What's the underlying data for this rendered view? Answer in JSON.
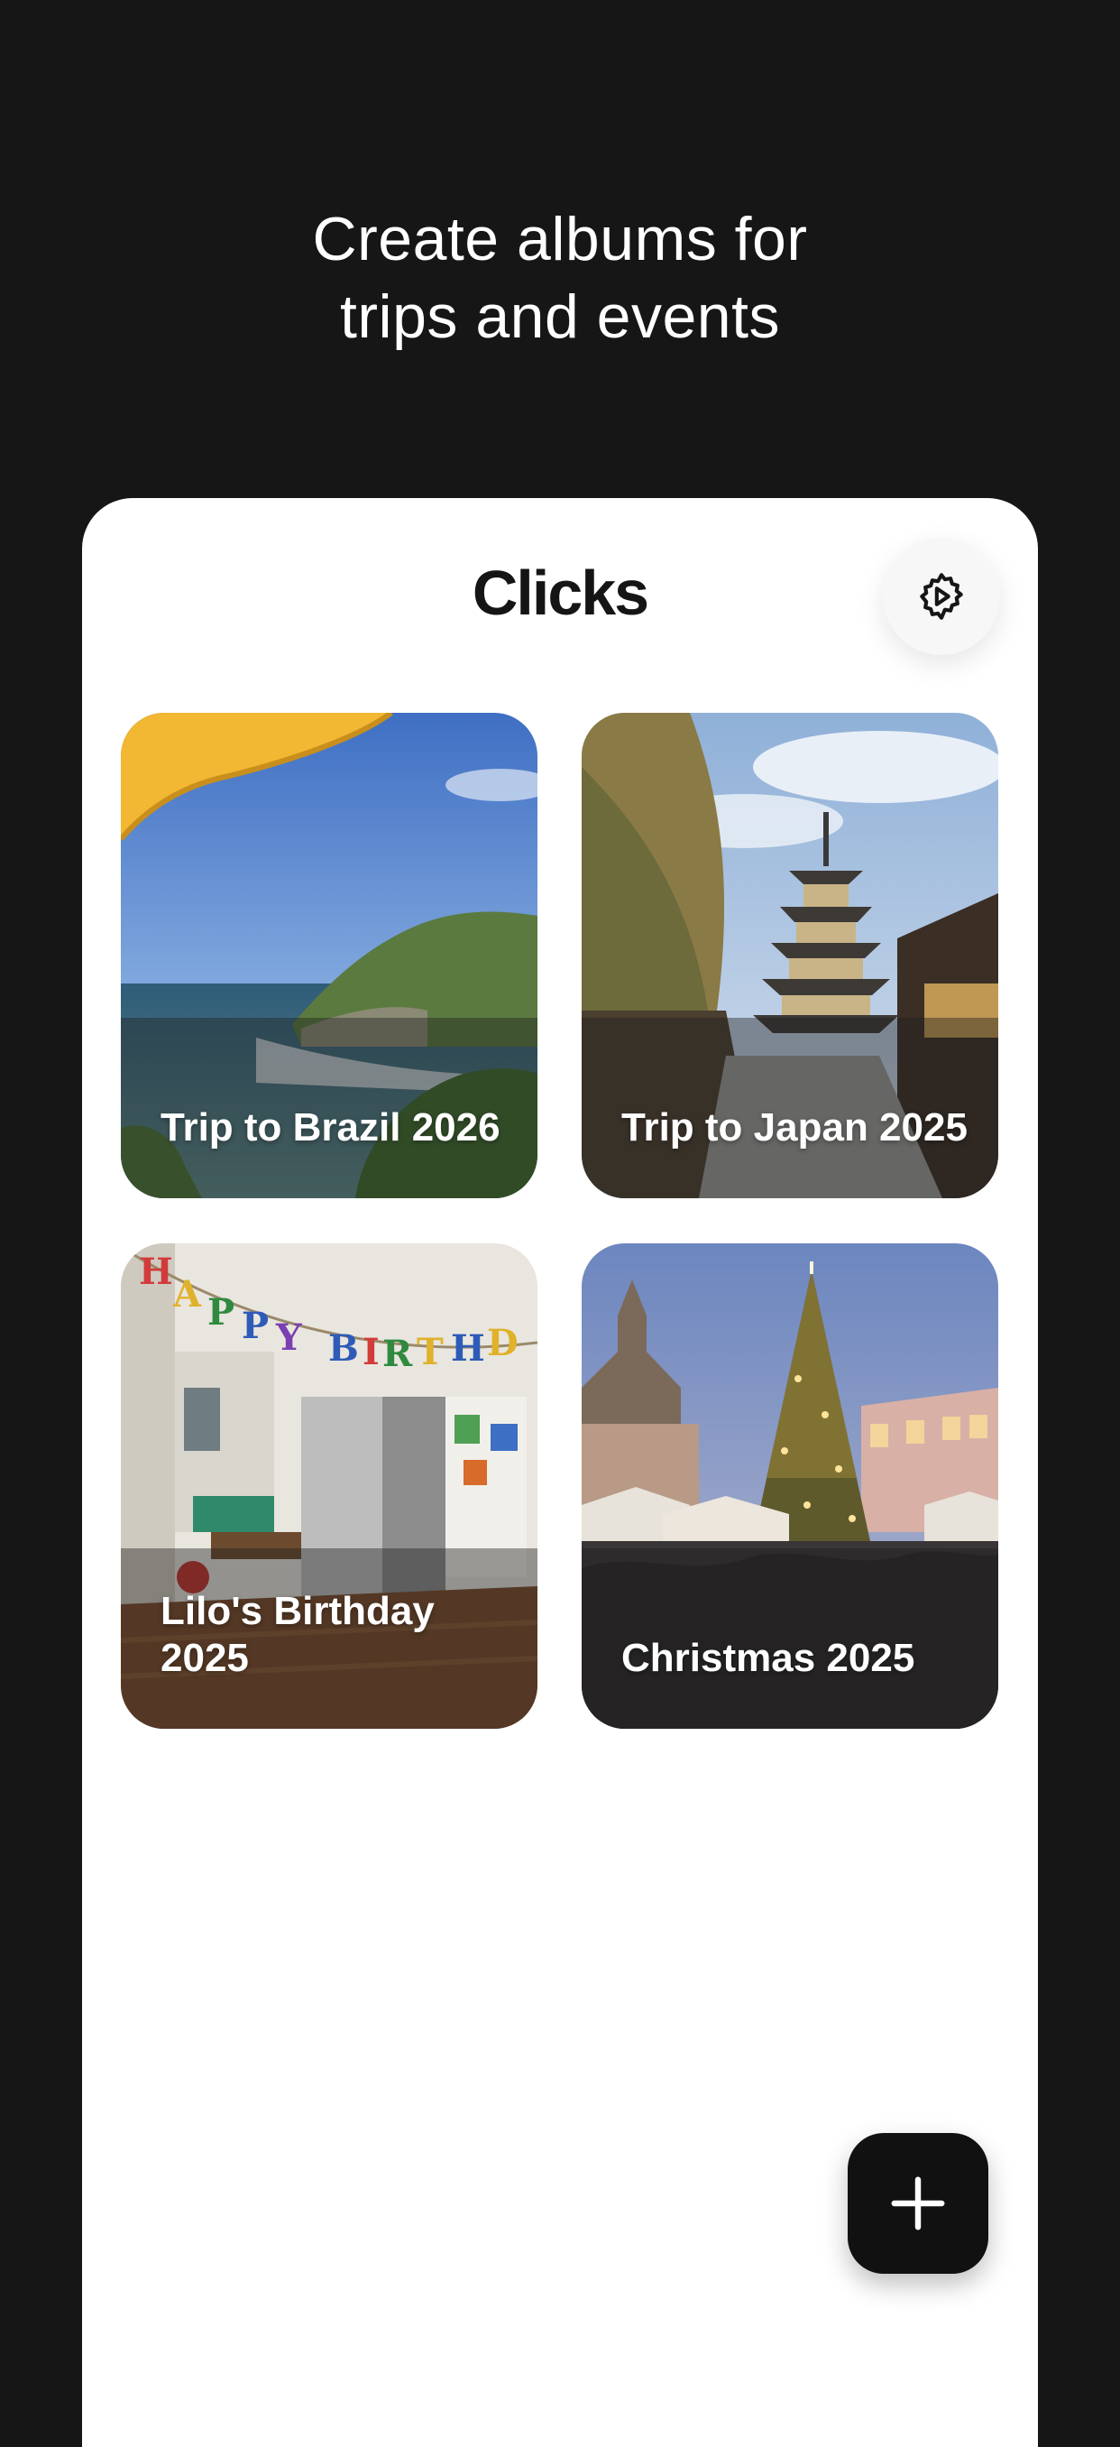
{
  "promo": {
    "headline_line1": "Create albums for",
    "headline_line2": "trips and events"
  },
  "app": {
    "title": "Clicks",
    "settings_icon": "settings-gear-icon",
    "add_icon": "plus-icon"
  },
  "albums": [
    {
      "title": "Trip to Brazil 2026"
    },
    {
      "title": "Trip to Japan 2025"
    },
    {
      "title": "Lilo's Birthday 2025"
    },
    {
      "title": "Christmas 2025"
    }
  ],
  "colors": {
    "background": "#161616",
    "card": "#ffffff",
    "fab": "#111111",
    "text_light": "#ffffff",
    "text_dark": "#151515"
  }
}
